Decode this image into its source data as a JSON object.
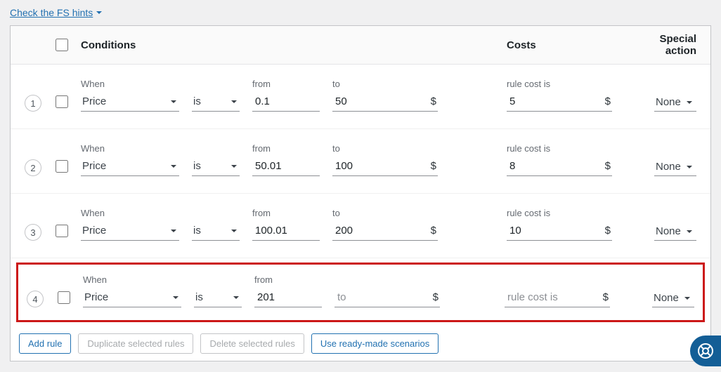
{
  "fs_link": "Check the FS hints",
  "headers": {
    "conditions": "Conditions",
    "costs": "Costs",
    "special": "Special action"
  },
  "labels": {
    "when": "When",
    "from": "from",
    "to": "to",
    "rule_cost": "rule cost is",
    "to_placeholder": "to",
    "cost_placeholder": "rule cost is"
  },
  "currency": "$",
  "rules": [
    {
      "num": "1",
      "when": "Price",
      "op": "is",
      "from": "0.1",
      "to": "50",
      "cost": "5",
      "special": "None",
      "highlight": false
    },
    {
      "num": "2",
      "when": "Price",
      "op": "is",
      "from": "50.01",
      "to": "100",
      "cost": "8",
      "special": "None",
      "highlight": false
    },
    {
      "num": "3",
      "when": "Price",
      "op": "is",
      "from": "100.01",
      "to": "200",
      "cost": "10",
      "special": "None",
      "highlight": false
    },
    {
      "num": "4",
      "when": "Price",
      "op": "is",
      "from": "201",
      "to": "",
      "cost": "",
      "special": "None",
      "highlight": true
    }
  ],
  "buttons": {
    "add": "Add rule",
    "dup": "Duplicate selected rules",
    "del": "Delete selected rules",
    "scenarios": "Use ready-made scenarios"
  }
}
